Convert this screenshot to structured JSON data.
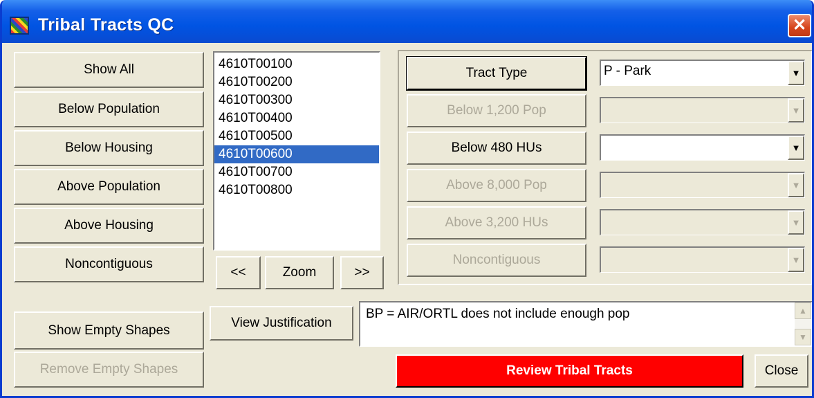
{
  "window": {
    "title": "Tribal Tracts QC",
    "close_glyph": "✕",
    "icon": "app-grid-icon"
  },
  "left_buttons": {
    "show_all": "Show All",
    "below_population": "Below Population",
    "below_housing": "Below Housing",
    "above_population": "Above Population",
    "above_housing": "Above Housing",
    "noncontiguous": "Noncontiguous",
    "show_empty_shapes": "Show Empty Shapes",
    "remove_empty_shapes": "Remove Empty Shapes"
  },
  "tract_list": {
    "items": [
      "4610T00100",
      "4610T00200",
      "4610T00300",
      "4610T00400",
      "4610T00500",
      "4610T00600",
      "4610T00700",
      "4610T00800"
    ],
    "selected_index": 5
  },
  "nav": {
    "prev": "<<",
    "zoom": "Zoom",
    "next": ">>"
  },
  "filters": {
    "tract_type": {
      "label": "Tract Type",
      "value": "P - Park",
      "enabled": true
    },
    "below_pop": {
      "label": "Below 1,200 Pop",
      "value": "",
      "enabled": false
    },
    "below_hus": {
      "label": "Below 480 HUs",
      "value": "",
      "enabled": true
    },
    "above_pop": {
      "label": "Above 8,000 Pop",
      "value": "",
      "enabled": false
    },
    "above_hus": {
      "label": "Above 3,200 HUs",
      "value": "",
      "enabled": false
    },
    "noncontiguous": {
      "label": "Noncontiguous",
      "value": "",
      "enabled": false
    }
  },
  "justification": {
    "button": "View Justification",
    "text": "BP = AIR/ORTL does not include enough pop"
  },
  "actions": {
    "review": "Review Tribal Tracts",
    "close": "Close"
  },
  "colors": {
    "title_bar": "#0054e3",
    "face": "#ece9d8",
    "selection": "#316ac5",
    "review_button": "#ff0000",
    "disabled_text": "#aca899"
  }
}
